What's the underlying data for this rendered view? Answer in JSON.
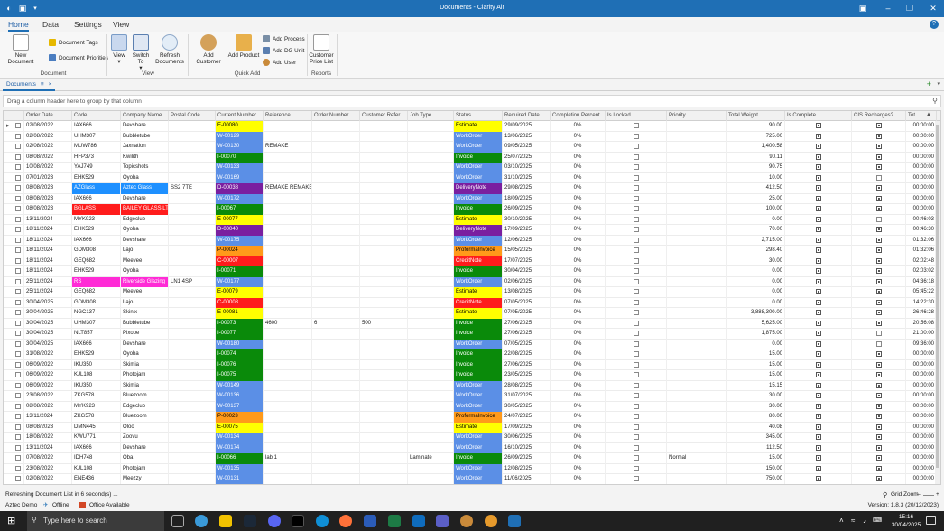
{
  "window": {
    "title": "Documents - Clarity Air"
  },
  "ribbon_tabs": [
    "Home",
    "Data",
    "Settings",
    "View"
  ],
  "ribbon": {
    "new_document": "New Document",
    "document_tags": "Document Tags",
    "document_priorities": "Document Priorities",
    "view": "View",
    "switch_to": "Switch To",
    "refresh_documents": "Refresh Documents",
    "add_customer": "Add Customer",
    "add_product": "Add Product",
    "add_process": "Add Process",
    "add_dg_unit": "Add DG Unit",
    "add_user": "Add User",
    "customer_price_list": "Customer Price List",
    "groups": {
      "document": "Document",
      "view": "View",
      "quick_add": "Quick Add",
      "reports": "Reports"
    }
  },
  "doc_tab": {
    "label": "Documents",
    "pin": "≡",
    "close": "×"
  },
  "group_panel": "Drag a column header here to group by that column",
  "columns": [
    "Order Date",
    "Code",
    "Company Name",
    "Postal Code",
    "Current Number",
    "Reference",
    "Order Number",
    "Customer Refer...",
    "Job Type",
    "Status",
    "Required Date",
    "Completion Percent",
    "Is Locked",
    "Priority",
    "Total Weight",
    "Is Complete",
    "CIS Recharges?",
    "Tot..."
  ],
  "rows": [
    [
      "02/08/2022",
      "IAX666",
      "Devshare",
      "",
      "E-00080",
      "",
      "",
      "",
      "",
      "Estimate",
      "29/09/2025",
      "0%",
      "",
      "",
      "90.00",
      "1",
      "1",
      "00:00:00"
    ],
    [
      "02/08/2022",
      "UHM307",
      "Bubbletube",
      "",
      "W-00129",
      "",
      "",
      "",
      "",
      "WorkOrder",
      "13/06/2025",
      "0%",
      "",
      "",
      "725.00",
      "1",
      "1",
      "00:00:00"
    ],
    [
      "02/08/2022",
      "MUW786",
      "Jaxnation",
      "",
      "W-00130",
      "REMAKE",
      "",
      "",
      "",
      "WorkOrder",
      "09/05/2025",
      "0%",
      "",
      "",
      "1,400.58",
      "1",
      "1",
      "00:00:00"
    ],
    [
      "08/08/2022",
      "HFP373",
      "Kwilith",
      "",
      "I-00070",
      "",
      "",
      "",
      "",
      "Invoice",
      "25/07/2025",
      "0%",
      "",
      "",
      "90.11",
      "1",
      "1",
      "00:00:00"
    ],
    [
      "10/08/2022",
      "YAJ749",
      "Topicshots",
      "",
      "W-00133",
      "",
      "",
      "",
      "",
      "WorkOrder",
      "03/10/2025",
      "0%",
      "",
      "",
      "90.75",
      "1",
      "1",
      "00:00:00"
    ],
    [
      "07/01/2023",
      "EHK529",
      "Oyoba",
      "",
      "W-00169",
      "",
      "",
      "",
      "",
      "WorkOrder",
      "31/10/2025",
      "0%",
      "",
      "",
      "10.00",
      "1",
      "0",
      "00:00:00"
    ],
    [
      "08/08/2023",
      "AZGlass",
      "Aztec Glass",
      "SS2 7TE",
      "D-00038",
      "REMAKE REMAKE",
      "",
      "",
      "",
      "DeliveryNote",
      "29/08/2025",
      "0%",
      "",
      "",
      "412.50",
      "1",
      "1",
      "00:00:00"
    ],
    [
      "08/08/2023",
      "IAX666",
      "Devshare",
      "",
      "W-00172",
      "",
      "",
      "",
      "",
      "WorkOrder",
      "18/09/2025",
      "0%",
      "",
      "",
      "25.00",
      "1",
      "1",
      "00:00:00"
    ],
    [
      "08/08/2023",
      "BGLASS",
      "BAILEY GLASS LTD",
      "",
      "I-00067",
      "",
      "",
      "",
      "",
      "Invoice",
      "26/09/2025",
      "0%",
      "",
      "",
      "100.00",
      "1",
      "1",
      "00:00:00"
    ],
    [
      "13/11/2024",
      "MYK923",
      "Edgeclub",
      "",
      "E-00077",
      "",
      "",
      "",
      "",
      "Estimate",
      "30/10/2025",
      "0%",
      "",
      "",
      "0.00",
      "1",
      "0",
      "00:46:03"
    ],
    [
      "18/11/2024",
      "EHK529",
      "Oyoba",
      "",
      "D-00040",
      "",
      "",
      "",
      "",
      "DeliveryNote",
      "17/09/2025",
      "0%",
      "",
      "",
      "70.00",
      "1",
      "1",
      "00:46:30"
    ],
    [
      "18/11/2024",
      "IAX666",
      "Devshare",
      "",
      "W-00175",
      "",
      "",
      "",
      "",
      "WorkOrder",
      "12/06/2025",
      "0%",
      "",
      "",
      "2,715.00",
      "1",
      "1",
      "01:32:06"
    ],
    [
      "18/11/2024",
      "GDM308",
      "Lajo",
      "",
      "P-00024",
      "",
      "",
      "",
      "",
      "ProformaInvoice",
      "15/05/2025",
      "0%",
      "",
      "",
      "298.40",
      "1",
      "1",
      "01:32:06"
    ],
    [
      "18/11/2024",
      "GEQ682",
      "Meevee",
      "",
      "C-00007",
      "",
      "",
      "",
      "",
      "CreditNote",
      "17/07/2025",
      "0%",
      "",
      "",
      "30.00",
      "1",
      "1",
      "02:02:48"
    ],
    [
      "18/11/2024",
      "EHK529",
      "Oyoba",
      "",
      "I-00071",
      "",
      "",
      "",
      "",
      "Invoice",
      "30/04/2025",
      "0%",
      "",
      "",
      "0.00",
      "1",
      "1",
      "02:03:02"
    ],
    [
      "25/11/2024",
      "RS",
      "Riverside Glazing",
      "LN1 4SP",
      "W-00177",
      "",
      "",
      "",
      "",
      "WorkOrder",
      "02/06/2025",
      "0%",
      "",
      "",
      "0.00",
      "1",
      "1",
      "04:36:18"
    ],
    [
      "25/11/2024",
      "GEQ682",
      "Meevee",
      "",
      "E-00079",
      "",
      "",
      "",
      "",
      "Estimate",
      "13/08/2025",
      "0%",
      "",
      "",
      "0.00",
      "1",
      "1",
      "05:45:22"
    ],
    [
      "30/04/2025",
      "GDM308",
      "Lajo",
      "",
      "C-00008",
      "",
      "",
      "",
      "",
      "CreditNote",
      "07/05/2025",
      "0%",
      "",
      "",
      "0.00",
      "1",
      "1",
      "14:22:30"
    ],
    [
      "30/04/2025",
      "NGC137",
      "Skinix",
      "",
      "E-00081",
      "",
      "",
      "",
      "",
      "Estimate",
      "07/05/2025",
      "0%",
      "",
      "",
      "3,888,300.00",
      "1",
      "1",
      "26:46:28"
    ],
    [
      "30/04/2025",
      "UHM307",
      "Bubbletube",
      "",
      "I-00073",
      "4600",
      "6",
      "500",
      "",
      "Invoice",
      "27/06/2025",
      "0%",
      "",
      "",
      "5,625.00",
      "1",
      "1",
      "20:56:08"
    ],
    [
      "30/04/2025",
      "NLT857",
      "Pixope",
      "",
      "I-00077",
      "",
      "",
      "",
      "",
      "Invoice",
      "27/06/2025",
      "0%",
      "",
      "",
      "1,875.00",
      "1",
      "0",
      "21:00:00"
    ],
    [
      "30/04/2025",
      "IAX666",
      "Devshare",
      "",
      "W-00180",
      "",
      "",
      "",
      "",
      "WorkOrder",
      "07/05/2025",
      "0%",
      "",
      "",
      "0.00",
      "1",
      "0",
      "09:36:00"
    ],
    [
      "31/08/2022",
      "EHK529",
      "Oyoba",
      "",
      "I-00074",
      "",
      "",
      "",
      "",
      "Invoice",
      "22/08/2025",
      "0%",
      "",
      "",
      "15.00",
      "1",
      "1",
      "00:00:00"
    ],
    [
      "06/09/2022",
      "IKU350",
      "Skimia",
      "",
      "I-00076",
      "",
      "",
      "",
      "",
      "Invoice",
      "27/06/2025",
      "0%",
      "",
      "",
      "15.00",
      "1",
      "1",
      "00:00:00"
    ],
    [
      "06/09/2022",
      "KJL108",
      "Photojam",
      "",
      "I-00075",
      "",
      "",
      "",
      "",
      "Invoice",
      "23/05/2025",
      "0%",
      "",
      "",
      "15.00",
      "1",
      "1",
      "00:00:00"
    ],
    [
      "06/09/2022",
      "IKU350",
      "Skimia",
      "",
      "W-00149",
      "",
      "",
      "",
      "",
      "WorkOrder",
      "28/08/2025",
      "0%",
      "",
      "",
      "15.15",
      "1",
      "1",
      "00:00:00"
    ],
    [
      "23/08/2022",
      "ZKG578",
      "Bluezoom",
      "",
      "W-00136",
      "",
      "",
      "",
      "",
      "WorkOrder",
      "31/07/2025",
      "0%",
      "",
      "",
      "30.00",
      "1",
      "1",
      "00:00:00"
    ],
    [
      "08/08/2022",
      "MYK923",
      "Edgeclub",
      "",
      "W-00137",
      "",
      "",
      "",
      "",
      "WorkOrder",
      "30/05/2025",
      "0%",
      "",
      "",
      "30.00",
      "1",
      "1",
      "00:00:00"
    ],
    [
      "13/11/2024",
      "ZKG578",
      "Bluezoom",
      "",
      "P-00023",
      "",
      "",
      "",
      "",
      "ProformaInvoice",
      "24/07/2025",
      "0%",
      "",
      "",
      "80.00",
      "1",
      "1",
      "00:00:00"
    ],
    [
      "08/08/2023",
      "DMN445",
      "Oloo",
      "",
      "E-00075",
      "",
      "",
      "",
      "",
      "Estimate",
      "17/09/2025",
      "0%",
      "",
      "",
      "40.08",
      "1",
      "1",
      "00:00:00"
    ],
    [
      "18/08/2022",
      "KWU771",
      "Zoovu",
      "",
      "W-00134",
      "",
      "",
      "",
      "",
      "WorkOrder",
      "30/06/2025",
      "0%",
      "",
      "",
      "345.00",
      "1",
      "1",
      "00:00:00"
    ],
    [
      "13/11/2024",
      "IAX666",
      "Devshare",
      "",
      "W-00174",
      "",
      "",
      "",
      "",
      "WorkOrder",
      "16/10/2025",
      "0%",
      "",
      "",
      "112.50",
      "1",
      "1",
      "00:00:00"
    ],
    [
      "07/08/2022",
      "IDH748",
      "Oba",
      "",
      "I-00066",
      "lab 1",
      "",
      "",
      "Laminate",
      "Invoice",
      "26/09/2025",
      "0%",
      "",
      "Normal",
      "15.00",
      "1",
      "1",
      "00:00:00"
    ],
    [
      "23/08/2022",
      "KJL108",
      "Photojam",
      "",
      "W-00135",
      "",
      "",
      "",
      "",
      "WorkOrder",
      "12/08/2025",
      "0%",
      "",
      "",
      "150.00",
      "1",
      "1",
      "00:00:00"
    ],
    [
      "02/08/2022",
      "ENE436",
      "Meezzy",
      "",
      "W-00131",
      "",
      "",
      "",
      "",
      "WorkOrder",
      "11/06/2025",
      "0%",
      "",
      "",
      "750.00",
      "1",
      "1",
      "00:00:00"
    ]
  ],
  "colors": {
    "Estimate": "#ffff00",
    "WorkOrder": "#5b8fe6",
    "Invoice": "#0a8a0a",
    "DeliveryNote": "#7a1fa0",
    "ProformaInvoice": "#ff9a1a",
    "CreditNote": "#ff1c1c",
    "AZGlass": "#1e90ff",
    "BGLASS": "#ff1c1c",
    "RS": "#ff2bd6"
  },
  "status": {
    "refresh": "Refreshing Document List in 6 second(s) ...",
    "grid_zoom": "Grid Zoom",
    "company": "Aztec Demo",
    "offline": "Offline",
    "office": "Office Available",
    "version": "Version: 1.8.3 (20/12/2023)"
  },
  "taskbar": {
    "search_placeholder": "Type here to search",
    "time": "15:16",
    "date": "30/04/2025"
  }
}
